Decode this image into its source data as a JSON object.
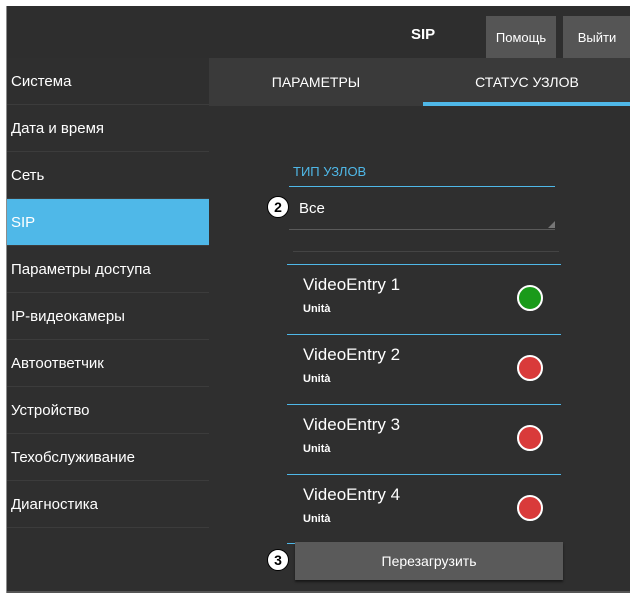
{
  "header": {
    "title": "SIP",
    "help_label": "Помощь",
    "logout_label": "Выйти"
  },
  "sidebar": {
    "items": [
      {
        "label": "Система",
        "active": false
      },
      {
        "label": "Дата и время",
        "active": false
      },
      {
        "label": "Сеть",
        "active": false
      },
      {
        "label": "SIP",
        "active": true
      },
      {
        "label": "Параметры доступа",
        "active": false
      },
      {
        "label": "IP-видеокамеры",
        "active": false
      },
      {
        "label": "Автоответчик",
        "active": false
      },
      {
        "label": "Устройство",
        "active": false
      },
      {
        "label": "Техобслуживание",
        "active": false
      },
      {
        "label": "Диагностика",
        "active": false
      }
    ]
  },
  "tabs": {
    "params_label": "ПАРАМЕТРЫ",
    "status_label": "СТАТУС УЗЛОВ",
    "active": "status"
  },
  "node_type": {
    "label": "ТИП УЗЛОВ",
    "value": "Все"
  },
  "nodes": [
    {
      "name": "VideoEntry 1",
      "sub": "Unità",
      "status_color": "#1a9a1a"
    },
    {
      "name": "VideoEntry 2",
      "sub": "Unità",
      "status_color": "#d93a3a"
    },
    {
      "name": "VideoEntry 3",
      "sub": "Unità",
      "status_color": "#d93a3a"
    },
    {
      "name": "VideoEntry 4",
      "sub": "Unità",
      "status_color": "#d93a3a"
    }
  ],
  "reboot_label": "Перезагрузить",
  "callouts": {
    "select": "2",
    "reboot": "3"
  },
  "colors": {
    "accent": "#4fb8e8",
    "background": "#2f2f2f",
    "status_ok": "#1a9a1a",
    "status_error": "#d93a3a"
  }
}
